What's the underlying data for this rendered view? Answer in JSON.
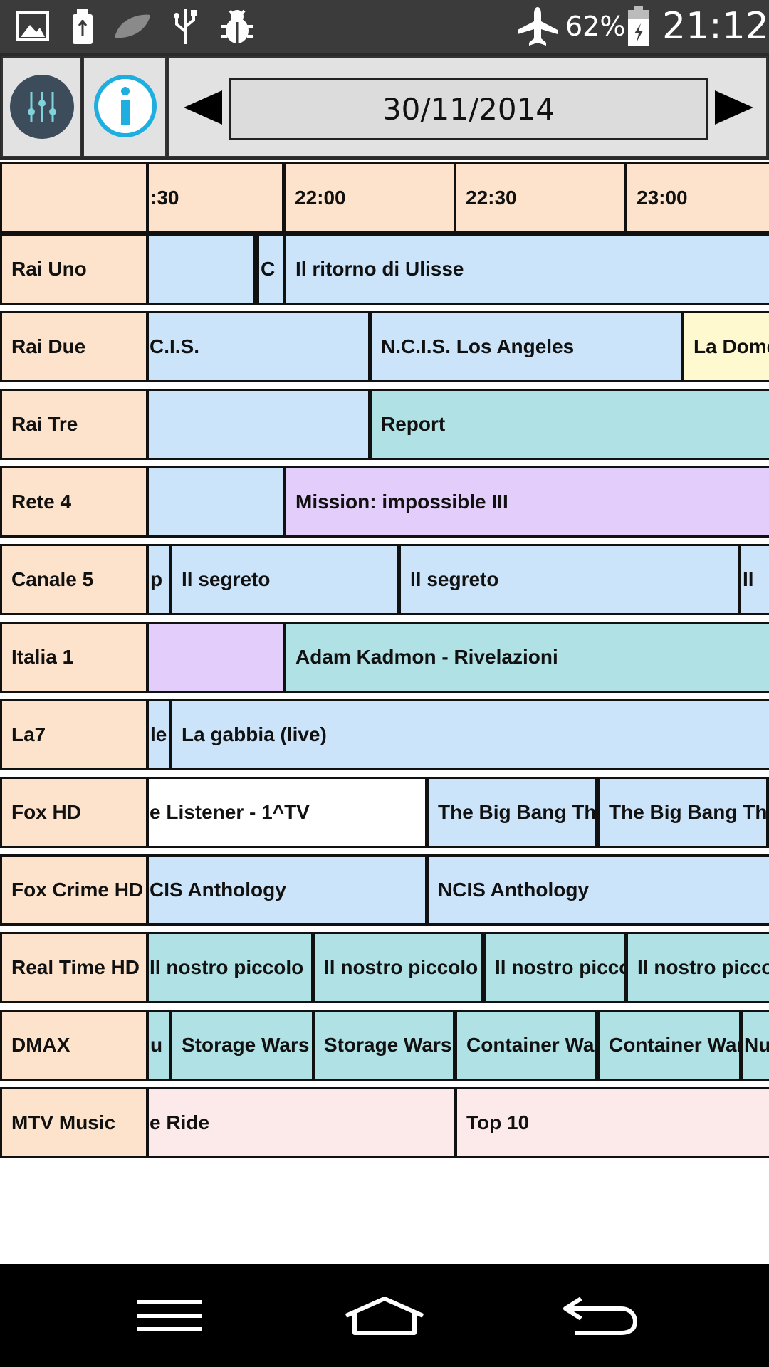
{
  "status_bar": {
    "battery_percent": "62%",
    "time": "21:12",
    "icons": [
      "image-icon",
      "usb-storage-icon",
      "leaf-icon",
      "usb-icon",
      "bug-icon",
      "airplane-icon",
      "battery-charging-icon"
    ]
  },
  "toolbar": {
    "date": "30/11/2014",
    "settings_icon": "equalizer-icon",
    "info_icon": "info-icon",
    "prev_icon": "triangle-left-icon",
    "next_icon": "triangle-right-icon"
  },
  "timeline": {
    "slots": [
      ":30",
      "22:00",
      "22:30",
      "23:00"
    ]
  },
  "colors": {
    "channel_bg": "#fde3cb",
    "blue": "#cce4fa",
    "teal": "#b0e1e5",
    "purple": "#e3cdfb",
    "yellow": "#fff9cf",
    "pink": "#fce9ea",
    "white": "#ffffff"
  },
  "channels": [
    {
      "name": "Rai Uno",
      "programs": [
        {
          "title": "",
          "color": "blue"
        },
        {
          "title": "C",
          "color": "blue"
        },
        {
          "title": "Il ritorno di Ulisse",
          "color": "blue"
        }
      ]
    },
    {
      "name": "Rai Due",
      "programs": [
        {
          "title": "C.I.S.",
          "color": "blue"
        },
        {
          "title": "N.C.I.S. Los Angeles",
          "color": "blue"
        },
        {
          "title": "La Domenica",
          "color": "yellow"
        }
      ]
    },
    {
      "name": "Rai Tre",
      "programs": [
        {
          "title": "",
          "color": "blue"
        },
        {
          "title": "Report",
          "color": "teal"
        }
      ]
    },
    {
      "name": "Rete 4",
      "programs": [
        {
          "title": "",
          "color": "blue"
        },
        {
          "title": "Mission: impossible III",
          "color": "purple"
        }
      ]
    },
    {
      "name": "Canale 5",
      "programs": [
        {
          "title": "p",
          "color": "blue"
        },
        {
          "title": "Il segreto",
          "color": "blue"
        },
        {
          "title": "Il segreto",
          "color": "blue"
        },
        {
          "title": "Il",
          "color": "blue"
        }
      ]
    },
    {
      "name": "Italia 1",
      "programs": [
        {
          "title": "",
          "color": "purple"
        },
        {
          "title": "Adam Kadmon - Rivelazioni",
          "color": "teal"
        }
      ]
    },
    {
      "name": "La7",
      "programs": [
        {
          "title": "le",
          "color": "blue"
        },
        {
          "title": "La gabbia  (live)",
          "color": "blue"
        }
      ]
    },
    {
      "name": "Fox HD",
      "programs": [
        {
          "title": "e Listener - 1^TV",
          "color": "white"
        },
        {
          "title": "The Big Bang Theory",
          "color": "blue"
        },
        {
          "title": "The Big Bang Theory",
          "color": "blue"
        }
      ]
    },
    {
      "name": "Fox Crime HD",
      "programs": [
        {
          "title": "CIS Anthology",
          "color": "blue"
        },
        {
          "title": "NCIS Anthology",
          "color": "blue"
        }
      ]
    },
    {
      "name": "Real Time HD",
      "programs": [
        {
          "title": "Il nostro piccolo",
          "color": "teal"
        },
        {
          "title": "Il nostro piccolo",
          "color": "teal"
        },
        {
          "title": "Il nostro piccolo",
          "color": "teal"
        },
        {
          "title": "Il nostro piccolo",
          "color": "teal"
        }
      ]
    },
    {
      "name": "DMAX",
      "programs": [
        {
          "title": "u",
          "color": "teal"
        },
        {
          "title": "Storage Wars",
          "color": "teal"
        },
        {
          "title": "Storage Wars",
          "color": "teal"
        },
        {
          "title": "Container Wars",
          "color": "teal"
        },
        {
          "title": "Container Wars",
          "color": "teal"
        },
        {
          "title": "Nu",
          "color": "teal"
        }
      ]
    },
    {
      "name": "MTV Music",
      "programs": [
        {
          "title": "e Ride",
          "color": "pink"
        },
        {
          "title": "Top 10",
          "color": "pink"
        }
      ]
    }
  ],
  "nav_bar": {
    "icons": [
      "menu-icon",
      "home-icon",
      "back-icon"
    ]
  }
}
